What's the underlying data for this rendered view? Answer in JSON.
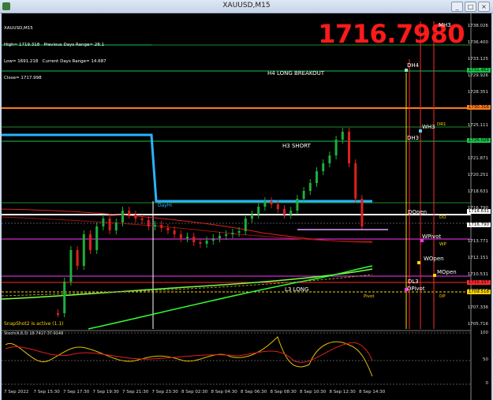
{
  "window": {
    "title": "XAUUSD,M15"
  },
  "info": {
    "symbol": "XAUUSD,M15",
    "line1": "High= 1719.318   Previous Days Range= 28.1",
    "line2": "Low= 1691.218   Current Days Range= 14.687",
    "line3": "Close= 1717.998"
  },
  "big_price": "1716.7980",
  "price_axis": [
    "1738.026",
    "1736.400",
    "1733.125",
    "1729.926",
    "1728.351",
    "1726.731",
    "1725.111",
    "1723.491",
    "1721.871",
    "1720.251",
    "1718.631",
    "1716.790",
    "1715.391",
    "1713.771",
    "1712.151",
    "1710.531",
    "1708.956",
    "1707.336",
    "1705.716"
  ],
  "price_tags": [
    {
      "text": "1731.462",
      "color": "#19c34a"
    },
    {
      "text": "1730.316",
      "color": "#ff7a1a"
    },
    {
      "text": "1726.028",
      "color": "#19c34a"
    },
    {
      "text": "1718.631",
      "color": "#ffffff"
    },
    {
      "text": "1716.790",
      "color": "#ffffff"
    },
    {
      "text": "1710.157",
      "color": "#ff2a2a"
    },
    {
      "text": "1709.518",
      "color": "#ffd400"
    }
  ],
  "levels": {
    "mh3": "MH3",
    "dh4": "DH4",
    "h4_breakout": "H4 LONG BREAKOUT",
    "wh3": "WH3",
    "dr1": "DR1",
    "dh3": "DH3",
    "h3_short": "H3 SHORT",
    "dayhi": "DayHi",
    "dopen": "DOpen",
    "do": "DO",
    "wpivot": "WPivot",
    "wp": "WP",
    "wopen": "WOpen",
    "mopen": "MOpen",
    "dl3": "DL3",
    "l3_long": "L3 LONG",
    "dpivot": "DPivot",
    "dp": "DP",
    "pivot": "Pivot"
  },
  "snapshot_text": "SnapShot2 is active (1.1)",
  "oscillator": {
    "label": "Stoch(4,8,3)  18.7417  37.9148",
    "levels": [
      "100",
      "50",
      "0"
    ]
  },
  "time_axis": [
    "7 Sep 2022",
    "7 Sep 15:30",
    "7 Sep 17:30",
    "7 Sep 19:30",
    "7 Sep 21:30",
    "7 Sep 23:30",
    "8 Sep 02:30",
    "8 Sep 04:30",
    "8 Sep 06:30",
    "8 Sep 08:30",
    "8 Sep 10:30",
    "8 Sep 12:30",
    "8 Sep 14:30"
  ],
  "colors": {
    "bull": "#1fae3b",
    "bear": "#e01f1f",
    "cyan": "#2ab3ff",
    "bg": "#000000"
  }
}
